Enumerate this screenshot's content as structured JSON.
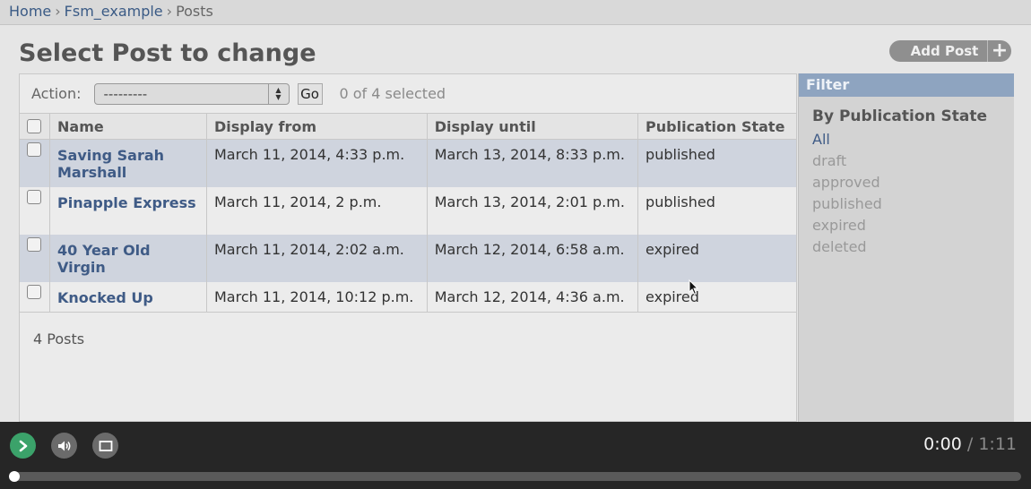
{
  "breadcrumbs": {
    "home": "Home",
    "app": "Fsm_example",
    "current": "Posts",
    "sep": "›"
  },
  "page_title": "Select Post to change",
  "add_button": {
    "label": "Add Post",
    "icon": "+"
  },
  "actions": {
    "label": "Action:",
    "select_value": "---------",
    "go_label": "Go",
    "selection_status": "0 of 4 selected"
  },
  "table": {
    "columns": [
      "Name",
      "Display from",
      "Display until",
      "Publication State"
    ],
    "rows": [
      {
        "name": "Saving Sarah Marshall",
        "display_from": "March 11, 2014, 4:33 p.m.",
        "display_until": "March 13, 2014, 8:33 p.m.",
        "state": "published"
      },
      {
        "name": "Pinapple Express",
        "display_from": "March 11, 2014, 2 p.m.",
        "display_until": "March 13, 2014, 2:01 p.m.",
        "state": "published"
      },
      {
        "name": "40 Year Old Virgin",
        "display_from": "March 11, 2014, 2:02 a.m.",
        "display_until": "March 12, 2014, 6:58 a.m.",
        "state": "expired"
      },
      {
        "name": "Knocked Up",
        "display_from": "March 11, 2014, 10:12 p.m.",
        "display_until": "March 12, 2014, 4:36 a.m.",
        "state": "expired"
      }
    ]
  },
  "paginator": "4 Posts",
  "filter": {
    "title": "Filter",
    "heading": "By Publication State",
    "options": [
      "All",
      "draft",
      "approved",
      "published",
      "expired",
      "deleted"
    ],
    "selected": "All"
  },
  "player": {
    "current_time": "0:00",
    "separator": "/",
    "duration": "1:11",
    "progress_fraction": 0,
    "play_color": "#3ba26a"
  }
}
